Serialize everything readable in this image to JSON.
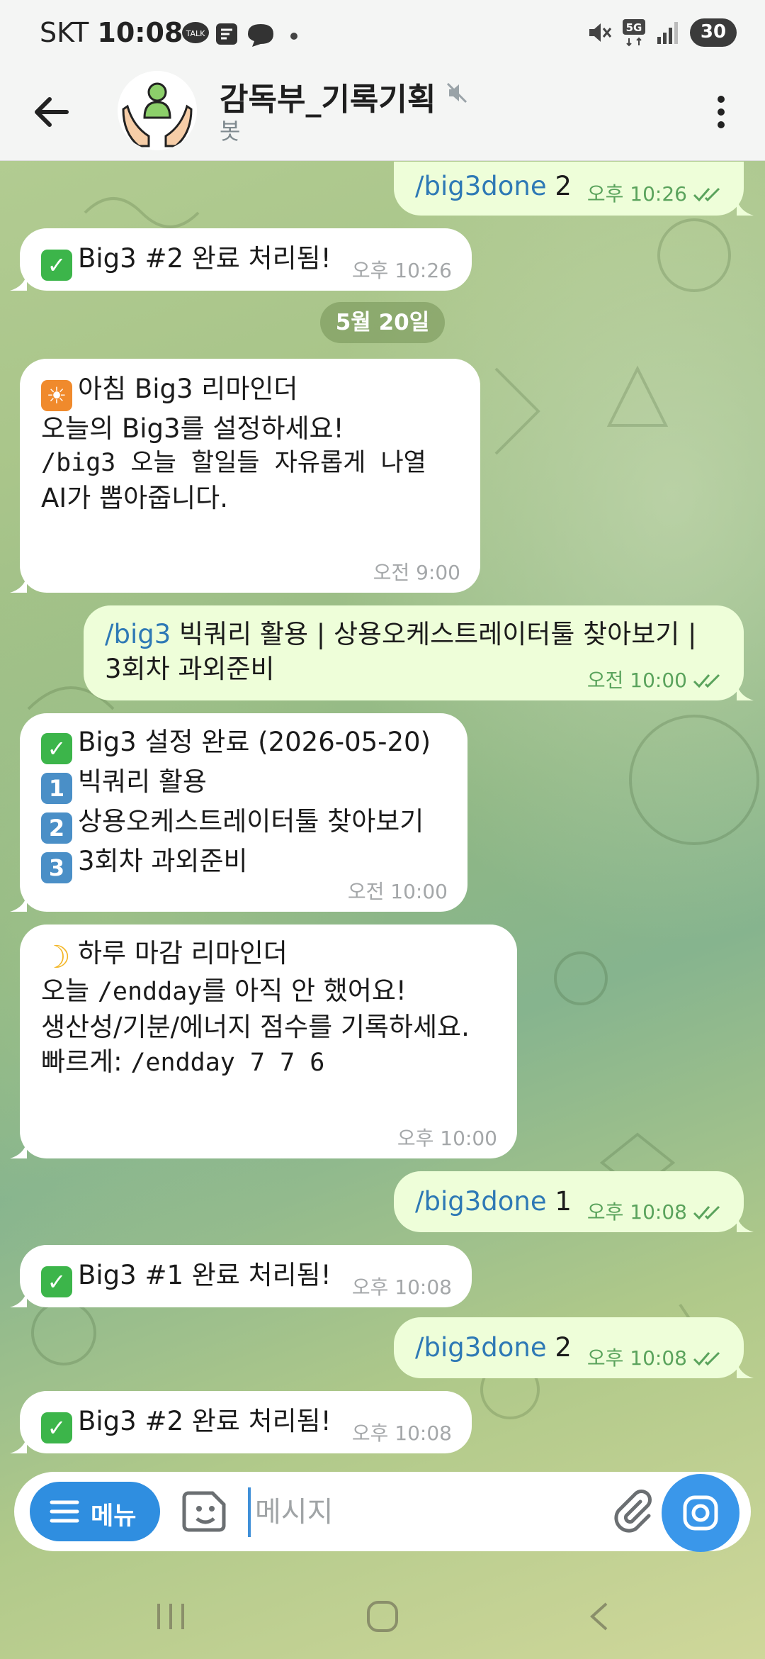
{
  "status_bar": {
    "carrier": "SKT",
    "time": "10:08",
    "battery": "30"
  },
  "header": {
    "title": "감독부_기록기획",
    "subtitle": "봇"
  },
  "date_divider": "5월 20일",
  "messages": [
    {
      "dir": "out",
      "cmd": "/big3done",
      "text": " 2",
      "time": "오후 10:26"
    },
    {
      "dir": "in",
      "lines": [
        "Big3 #2 완료 처리됨!"
      ],
      "time": "오후 10:26"
    },
    {
      "dir": "in",
      "lines": [
        "아침 Big3 리마인더",
        "",
        "오늘의 Big3를 설정하세요!",
        "/big3 오늘 할일들 자유롭게 나열",
        "",
        "AI가 뽑아줍니다."
      ],
      "time": "오전 9:00"
    },
    {
      "dir": "out",
      "cmd": "/big3",
      "lines": [
        " 빅쿼리 활용 | 상용오케스트레이터툴 찾아보기 |",
        "3회차 과외준비"
      ],
      "time": "오전 10:00"
    },
    {
      "dir": "in",
      "lines": [
        "Big3 설정 완료 (2026-05-20)",
        "",
        "빅쿼리 활용",
        "상용오케스트레이터툴 찾아보기",
        "3회차 과외준비"
      ],
      "time": "오전 10:00"
    },
    {
      "dir": "in",
      "lines": [
        "하루 마감 리마인더",
        "",
        "오늘 ",
        "/endday",
        "를 아직 안 했어요!",
        "생산성/기분/에너지 점수를 기록하세요.",
        "",
        "빠르게: ",
        "/endday 7 7 6"
      ],
      "time": "오후 10:00"
    },
    {
      "dir": "out",
      "cmd": "/big3done",
      "text": " 1",
      "time": "오후 10:08"
    },
    {
      "dir": "in",
      "lines": [
        "Big3 #1 완료 처리됨!"
      ],
      "time": "오후 10:08"
    },
    {
      "dir": "out",
      "cmd": "/big3done",
      "text": " 2",
      "time": "오후 10:08"
    },
    {
      "dir": "in",
      "lines": [
        "Big3 #2 완료 처리됨!"
      ],
      "time": "오후 10:08"
    }
  ],
  "emoji": {
    "check": "check-mark-emoji",
    "sunrise": "sunrise-emoji",
    "moon": "crescent-moon-emoji",
    "keycap1": "1",
    "keycap2": "2",
    "keycap3": "3"
  },
  "input": {
    "menu_label": "메뉴",
    "placeholder": "메시지"
  },
  "colors": {
    "accent": "#2f8ee0",
    "outgoing_bubble": "#eefed9",
    "incoming_bubble": "#ffffff",
    "command_link": "#2e79b5",
    "read_check": "#5aa35c"
  }
}
